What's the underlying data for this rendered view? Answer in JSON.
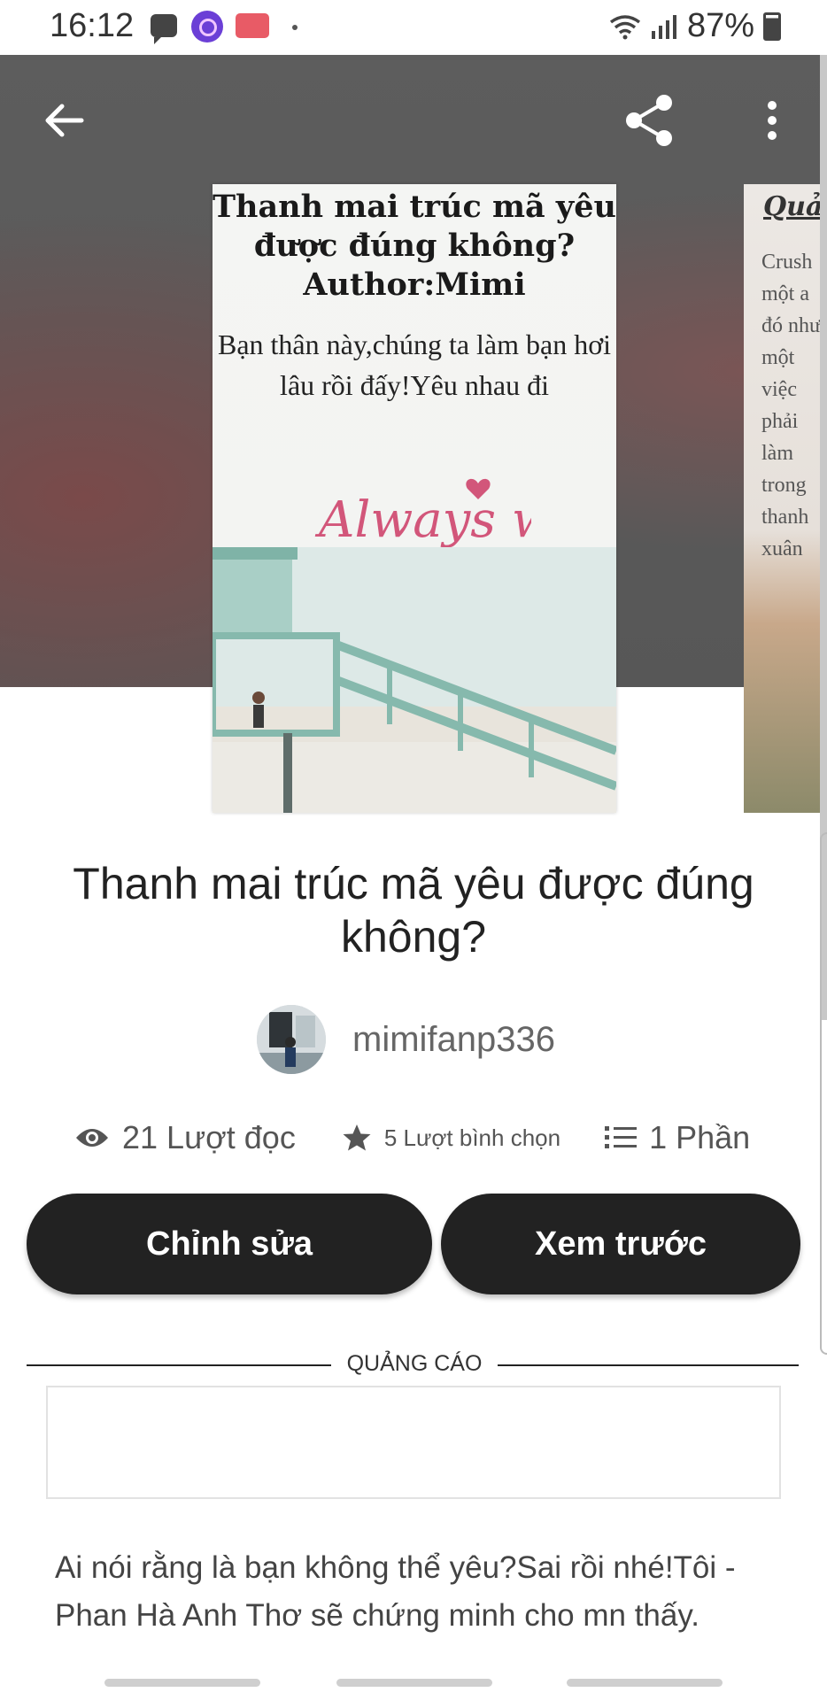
{
  "status_bar": {
    "time": "16:12",
    "battery": "87%"
  },
  "cover": {
    "title": "Thanh mai trúc mã yêu được đúng không? Author:Mimi",
    "blurb": "Bạn thân này,chúng ta làm bạn hơi lâu rồi đấy!Yêu nhau đi",
    "art_text": "Always with you"
  },
  "side_cover": {
    "title": "Quả",
    "lines": "Crush\nmột a\nđó như\nmột\nviệc\nphải\nlàm\ntrong\nthanh\nxuân"
  },
  "story": {
    "title": "Thanh mai trúc mã yêu được đúng không?",
    "author": "mimifanp336",
    "reads": "21 Lượt đọc",
    "votes": "5 Lượt bình chọn",
    "parts": "1 Phần",
    "description": "Ai nói rằng là bạn không thể yêu?Sai rồi nhé!Tôi - Phan Hà Anh Thơ sẽ chứng minh cho mn thấy."
  },
  "buttons": {
    "edit": "Chỉnh sửa",
    "preview": "Xem trước"
  },
  "ad": {
    "label": "QUẢNG CÁO"
  },
  "colors": {
    "button_bg": "#222222",
    "hero_bg": "#5a5a5a"
  }
}
